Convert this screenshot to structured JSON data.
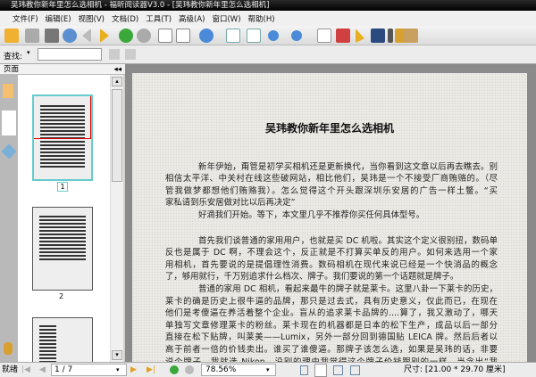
{
  "window": {
    "title": "吴玮教你新年里怎么选相机 - 福昕阅读器V3.0 - [吴玮教你新年里怎么选相机]"
  },
  "menu": [
    "文件(F)",
    "编辑(E)",
    "视图(V)",
    "文档(D)",
    "工具(T)",
    "高级(A)",
    "窗口(W)",
    "帮助(H)"
  ],
  "search": {
    "label": "查找:",
    "value": ""
  },
  "panel": {
    "title": "页面",
    "thumbnails": [
      "1",
      "2"
    ]
  },
  "document": {
    "title": "吴玮教你新年里怎么选相机",
    "lines": [
      "新年伊始，甭管是初学买相机还是更新换代，当你看到这文章以后再去瞧去。别",
      "相信太平洋、中关村在线这些破网站，相比他们，吴玮是一个不接受厂商贿赂的。（尽",
      "管我做梦都想他们贿赂我）。怎么觉得这个开头跟深圳乐安居的广告一样土鳖。“买",
      "家私请到乐安居做对比以后再决定”",
      "好滴我们开始。等下，本文里几乎不推荐你买任何具体型号。",
      "首先我们谈普通的家用用户，也就是买 DC 机啦。其实这个定义很别扭，数码单",
      "反也是属于 DC 啊，不理会这个，反正就是不打算买单反的用户。如何来选用一个家",
      "用相机，首先要说的是提倡理性消费。数码相机在现代来说已经是一个快消品的概念",
      "了，够用就行，千万别追求什么档次、牌子。我们要说的第一个话题就是牌子。",
      "普通的家用 DC 相机，看起来最牛的牌子就是莱卡。这里八卦一下莱卡的历史，",
      "莱卡的确是历史上很牛逼的品牌，那只是过去式，具有历史意义，仅此而已，在现在",
      "他们是考傻逼在养活着整个企业。盲从的追求莱卡品牌的....算了，我又激动了，哪天",
      "单独写文章修理莱卡的粉丝。莱卡现在的机器都是日本的松下生产，成品以后一部分",
      "直接在松下贴牌，叫莱美——Lumix，另外一部分回到德国贴 LEICA 牌。然后后者以",
      "高于前者一倍的价钱卖出。谁买了谁傻逼。那牌子该怎么选，如果是吴玮的话，非要",
      "说个牌子，我就选 Nikon，没别的理由我觉得这个牌子价钱跟别的一样，当念出“我"
    ]
  },
  "status": {
    "label": "就绪",
    "page": "1 / 7",
    "zoom": "78.56%",
    "size": "尺寸: [21.00 * 29.70 厘米]"
  }
}
